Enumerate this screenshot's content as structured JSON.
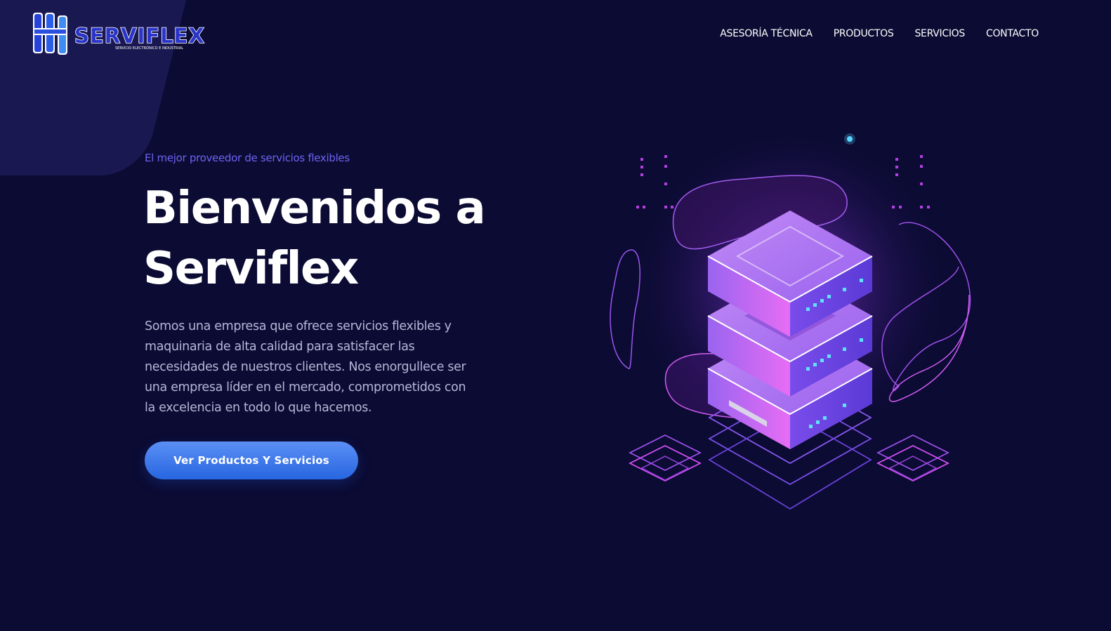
{
  "brand": {
    "logo_text": "SERVIFLEX",
    "logo_subtext": "SERVICIO ELECTRÓNICO E INDUSTRIAL"
  },
  "nav": {
    "items": [
      {
        "label": "ASESORÍA TÉCNICA"
      },
      {
        "label": "PRODUCTOS"
      },
      {
        "label": "SERVICIOS"
      },
      {
        "label": "CONTACTO"
      }
    ]
  },
  "hero": {
    "tagline": "El mejor proveedor de servicios flexibles",
    "title_line1": "Bienvenidos a",
    "title_line2": "Serviflex",
    "description": "Somos una empresa que ofrece servicios flexibles y maquinaria de alta calidad para satisfacer las necesidades de nuestros clientes. Nos enorgullece ser una empresa líder en el mercado, comprometidos con la excelencia en todo lo que hacemos.",
    "cta_label": "Ver Productos Y Servicios"
  },
  "colors": {
    "background": "#0b0b33",
    "accent": "#6f63f2",
    "button": "#3b7be8",
    "illustration_pink": "#e35cf2",
    "illustration_purple": "#8a5cf2"
  },
  "icons": {
    "illustration": "isometric-server-stack-icon"
  }
}
